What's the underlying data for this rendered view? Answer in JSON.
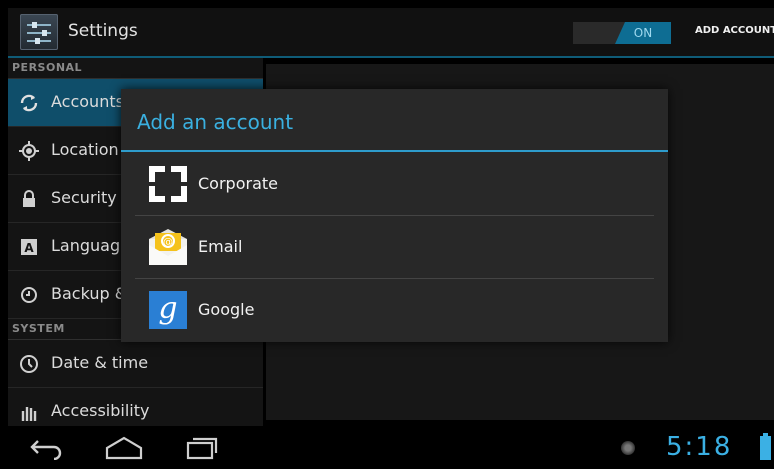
{
  "action_bar": {
    "title": "Settings",
    "toggle_label": "ON",
    "add_account_label": "ADD ACCOUNT"
  },
  "sidebar": {
    "personal_header": "PERSONAL",
    "system_header": "SYSTEM",
    "personal_items": [
      {
        "label": "Accounts",
        "icon": "sync-icon",
        "selected": true
      },
      {
        "label": "Location",
        "icon": "location-icon"
      },
      {
        "label": "Security",
        "icon": "lock-icon"
      },
      {
        "label": "Languag",
        "icon": "keyboard-icon"
      },
      {
        "label": "Backup &",
        "icon": "backup-icon"
      }
    ],
    "system_items": [
      {
        "label": "Date & time",
        "icon": "clock-icon"
      },
      {
        "label": "Accessibility",
        "icon": "hand-icon"
      }
    ]
  },
  "dialog": {
    "title": "Add an account",
    "options": [
      {
        "label": "Corporate",
        "icon": "corporate-icon"
      },
      {
        "label": "Email",
        "icon": "email-icon"
      },
      {
        "label": "Google",
        "icon": "google-icon"
      }
    ]
  },
  "status_bar": {
    "time": "5:18"
  },
  "colors": {
    "accent": "#33b5e5",
    "selected_bg": "#0f4e6a"
  }
}
